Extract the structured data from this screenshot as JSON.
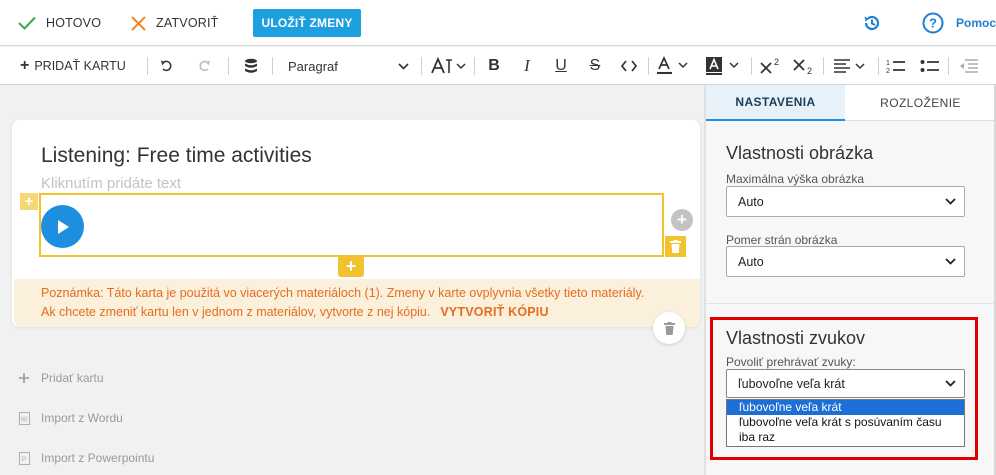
{
  "topbar": {
    "done_label": "HOTOVO",
    "close_label": "ZATVORIŤ",
    "save_label": "ULOŽIŤ ZMENY",
    "help_label": "Pomoc",
    "icons": [
      "checkmark-icon",
      "close-x-icon",
      "history-icon",
      "help-icon"
    ]
  },
  "toolbar": {
    "add_card_label": "PRIDAŤ KARTU",
    "paragraph_value": "Paragraf",
    "icons": [
      "undo-icon",
      "redo-icon",
      "database-icon",
      "chevron-down-icon",
      "font-size-icon",
      "bold-icon",
      "italic-icon",
      "underline-icon",
      "strikethrough-icon",
      "code-icon",
      "text-color-icon",
      "highlight-icon",
      "superscript-icon",
      "subscript-icon",
      "align-icon",
      "ordered-list-icon",
      "bullet-list-icon",
      "outdent-icon"
    ]
  },
  "card": {
    "title": "Listening: Free time activities",
    "placeholder": "Kliknutím pridáte text",
    "note_line1": "Poznámka: Táto karta je použitá vo viacerých materiáloch (1). Zmeny v karte ovplyvnia všetky tieto materiály.",
    "note_line2": "Ak chcete zmeniť kartu len v jednom z materiálov, vytvorte z nej kópiu.",
    "note_action": "VYTVORIŤ KÓPIU"
  },
  "sidebar_links": {
    "add_card": "Pridať kartu",
    "import_word": "Import z Wordu",
    "import_powerpoint": "Import z Powerpointu"
  },
  "panel": {
    "tab_settings": "NASTAVENIA",
    "tab_layout": "ROZLOŽENIE",
    "image_section_title": "Vlastnosti obrázka",
    "max_height_label": "Maximálna výška obrázka",
    "max_height_value": "Auto",
    "aspect_label": "Pomer strán obrázka",
    "aspect_value": "Auto",
    "sound_section_title": "Vlastnosti zvukov",
    "allow_play_label": "Povoliť prehrávať zvuky:",
    "allow_play_value": "ľubovoľne veľa krát",
    "options": [
      "ľubovoľne veľa krát",
      "ľubovoľne veľa krát s posúvaním času",
      "iba raz"
    ]
  },
  "colors": {
    "accent": "#1e9fe0",
    "highlight_border": "#f0c22b",
    "note_text": "#e46d1f",
    "note_bg": "#fbf0db",
    "annotation_red": "#e00000",
    "selected_option": "#1b6fd6"
  }
}
